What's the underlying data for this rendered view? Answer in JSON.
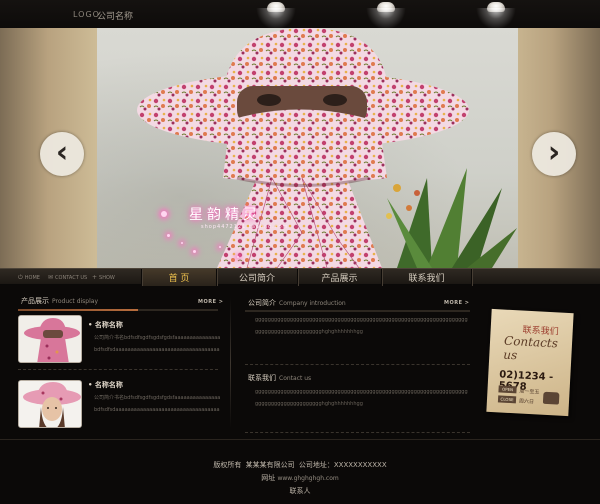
{
  "header": {
    "logo": "LOGO",
    "company_name": "公司名称"
  },
  "banner": {
    "caption_zh": "星韵精灵",
    "caption_en": "shop4472121.taobao.com",
    "prev_icon": "chevron-left-icon",
    "next_icon": "chevron-right-icon"
  },
  "toolbar": {
    "home": "HOME",
    "contact": "CONTACT US",
    "sitemap": "SHOW",
    "home_icon": "power-icon",
    "contact_icon": "mail-icon",
    "sitemap_icon": "plus-icon"
  },
  "nav": {
    "home": "首 页",
    "about": "公司简介",
    "products": "产品展示",
    "contact": "联系我们"
  },
  "products": {
    "title_zh": "产品展示",
    "title_en": "Product display",
    "more": "MORE >",
    "items": [
      {
        "name": "• 名称名称",
        "desc": "公司简介书名bdfsdfsgdfsgdsfgdsfaaaaaaaaaaaaaaabdfsdfsdaaaaaaaaaaaaaaaaaaaaaaaaaaaaaaaaaaa"
      },
      {
        "name": "• 名称名称",
        "desc": "公司简介书名bdfsdfsgdfsgdsfgdsfaaaaaaaaaaaaaaabdfsdfsdaaaaaaaaaaaaaaaaaaaaaaaaaaaaaaaaaaa"
      }
    ]
  },
  "about": {
    "title_zh": "公司简介",
    "title_en": "Company introduction",
    "more": "MORE >",
    "text": "gggggggggggggggggggggggggggggggggggggggggggggggggggggggggggggggggggggggggggggggggggggggghghghhhhhhhgg"
  },
  "contact": {
    "title_zh": "联系我们",
    "title_en": "Contact us",
    "text": "gggggggggggggggggggggggggggggggggggggggggggggggggggggggggggggggggggggggggggggggggggggggghghghhhhhhhgg"
  },
  "card": {
    "title_zh": "联系我们",
    "title_en": "Contacts us",
    "phone": "02)1234 - 5678",
    "open_label": "OPEN",
    "open_time": "周一至五",
    "close_label": "CLOSE",
    "close_time": "周六日",
    "phone_icon": "telephone-icon"
  },
  "footer": {
    "copyright": "版权所有",
    "company": "某某某有限公司",
    "address_label": "公司地址：",
    "address": "XXXXXXXXXXX",
    "website_label": "网址",
    "website": "www.ghghghgh.com",
    "contact_person": "联系人"
  }
}
